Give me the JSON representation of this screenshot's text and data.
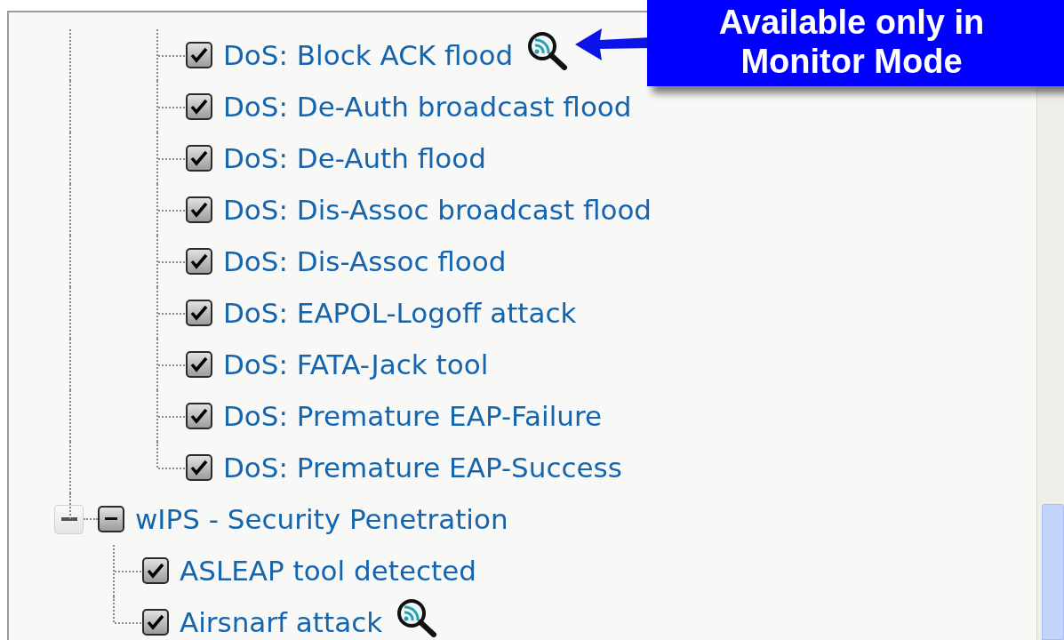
{
  "callout": {
    "lines": [
      "Available only in",
      "Monitor Mode"
    ]
  },
  "tree": [
    {
      "children": [
        {
          "label": "DoS: Block ACK flood",
          "checked": true,
          "monitor_mode": true
        },
        {
          "label": "DoS: De-Auth broadcast flood",
          "checked": true,
          "monitor_mode": false
        },
        {
          "label": "DoS: De-Auth flood",
          "checked": true,
          "monitor_mode": false
        },
        {
          "label": "DoS: Dis-Assoc broadcast flood",
          "checked": true,
          "monitor_mode": false
        },
        {
          "label": "DoS: Dis-Assoc flood",
          "checked": true,
          "monitor_mode": false
        },
        {
          "label": "DoS: EAPOL-Logoff attack",
          "checked": true,
          "monitor_mode": false
        },
        {
          "label": "DoS: FATA-Jack tool",
          "checked": true,
          "monitor_mode": false
        },
        {
          "label": "DoS: Premature EAP-Failure",
          "checked": true,
          "monitor_mode": false
        },
        {
          "label": "DoS: Premature EAP-Success",
          "checked": true,
          "monitor_mode": false
        }
      ]
    },
    {
      "label": "wIPS - Security Penetration",
      "expanded": true,
      "partial": true,
      "children": [
        {
          "label": "ASLEAP tool detected",
          "checked": true,
          "monitor_mode": false
        },
        {
          "label": "Airsnarf attack",
          "checked": true,
          "monitor_mode": true
        }
      ]
    }
  ]
}
